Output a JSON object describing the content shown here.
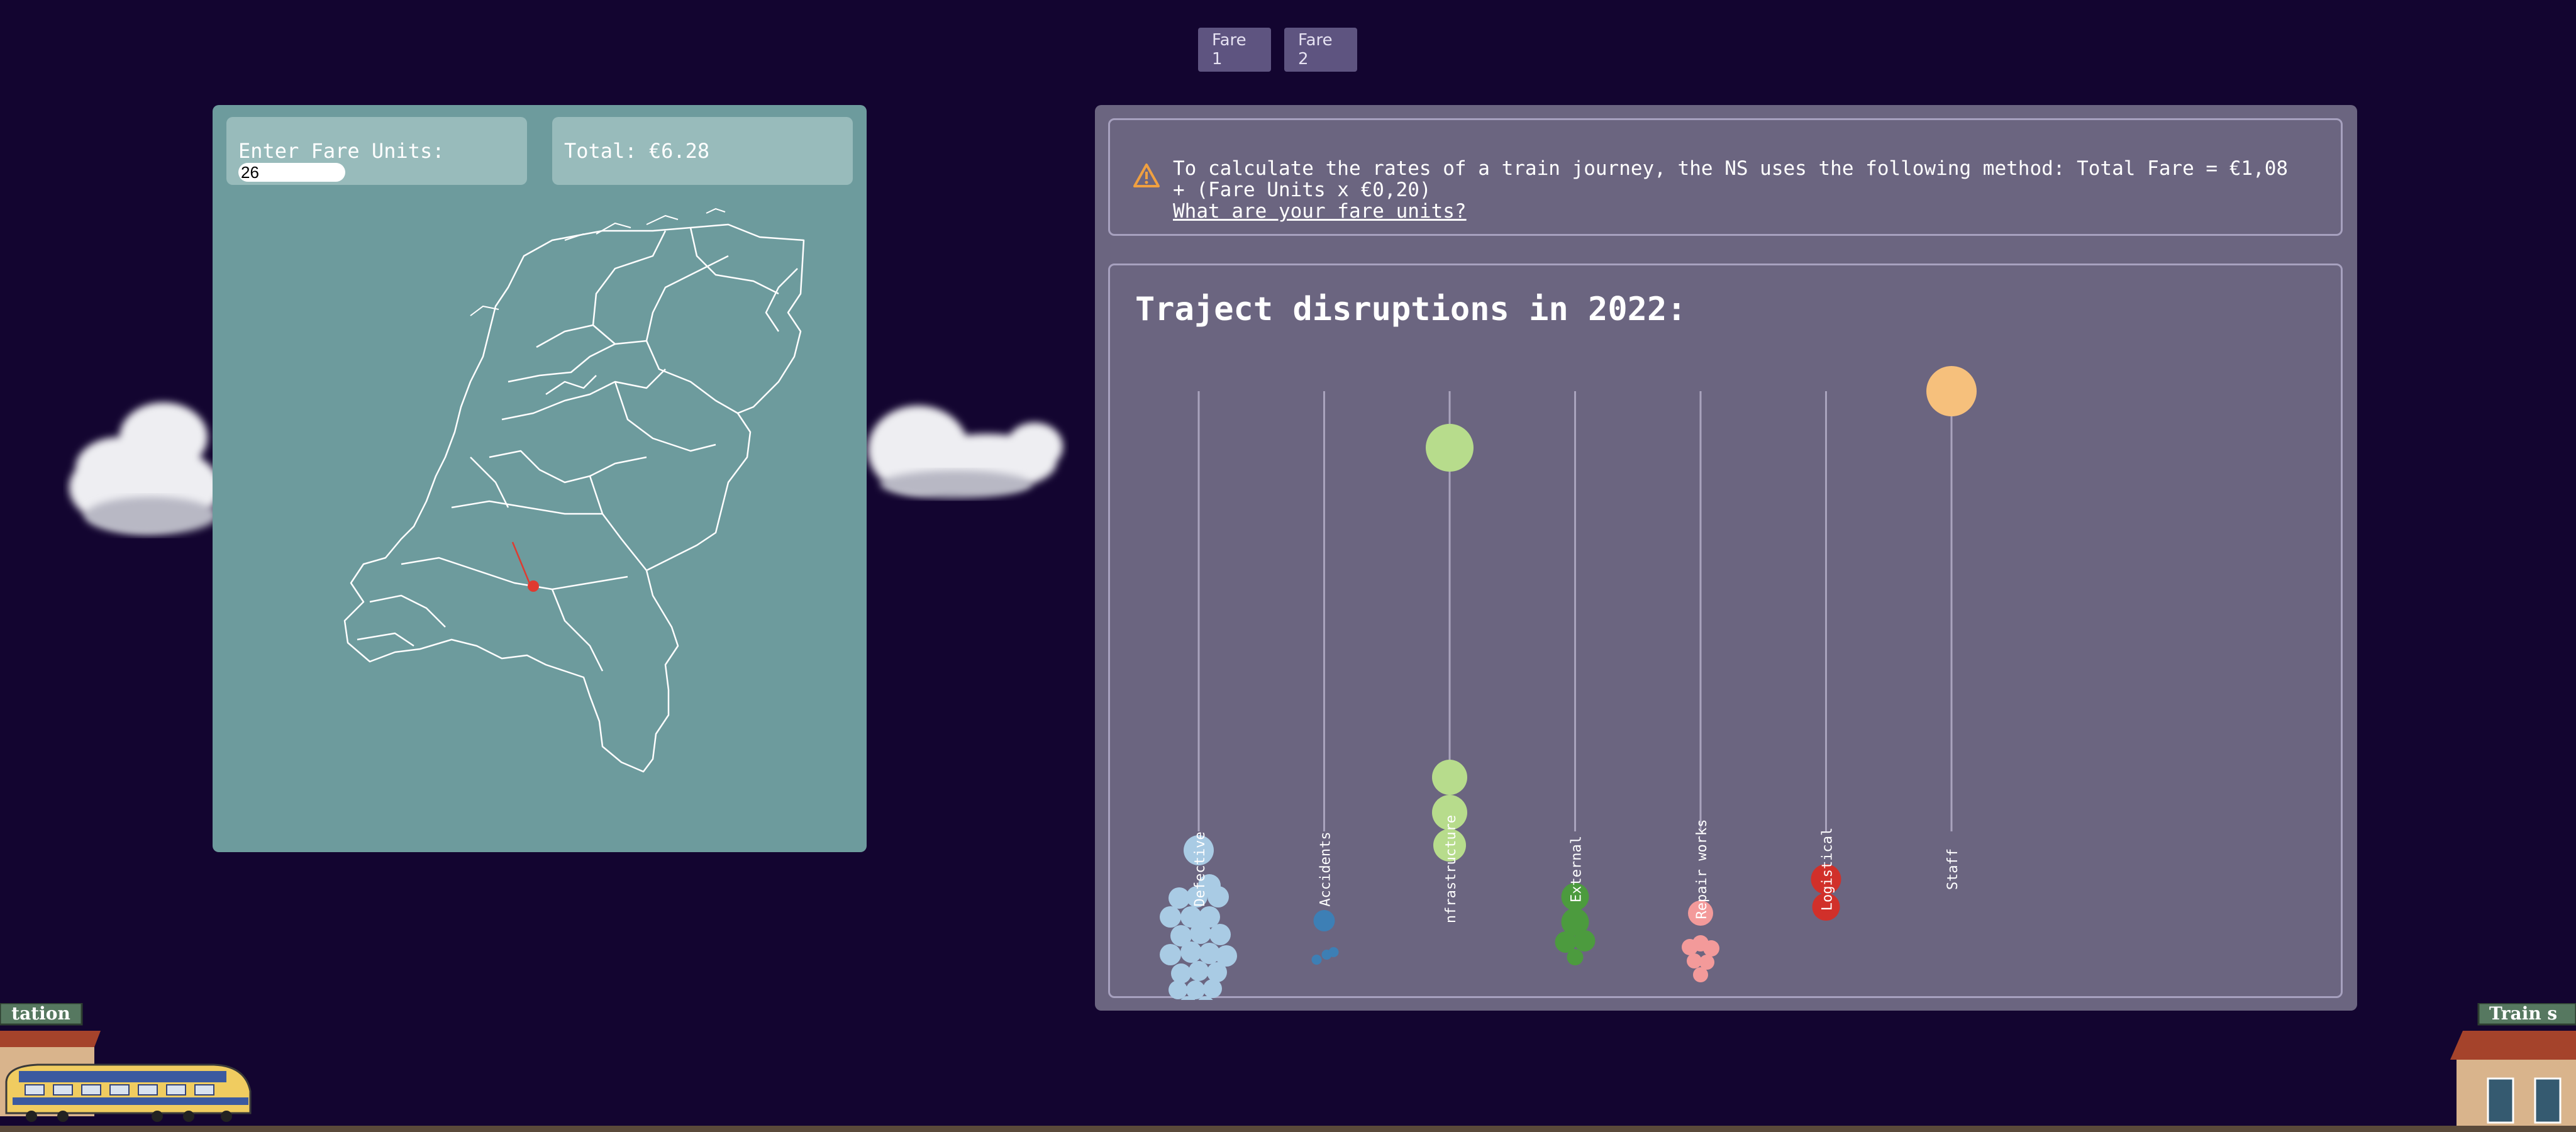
{
  "tabs": [
    {
      "label": "Fare 1"
    },
    {
      "label": "Fare 2"
    }
  ],
  "fare": {
    "input_label": "Enter Fare Units:",
    "input_value": "26",
    "total_text": "Total: €6.28"
  },
  "info": {
    "text": "To calculate the rates of a train journey, the NS uses the following method: Total Fare = €1,08 + (Fare Units x €0,20)",
    "link": "What are your fare units?",
    "warning_color": "#f0a040"
  },
  "stations": {
    "left_sign": "tation",
    "right_sign": "Train s"
  },
  "chart_data": {
    "type": "scatter",
    "title": "Traject disruptions in 2022:",
    "categories": [
      "Defective",
      "Accidents",
      "nfrastructure",
      "External",
      "Repair works",
      "Logistical",
      "Staff"
    ],
    "colors": [
      "#a9cbe4",
      "#3d7fb5",
      "#b7dc8c",
      "#4c9b3e",
      "#f39a9a",
      "#d1302a",
      "#f6c07c"
    ]
  }
}
